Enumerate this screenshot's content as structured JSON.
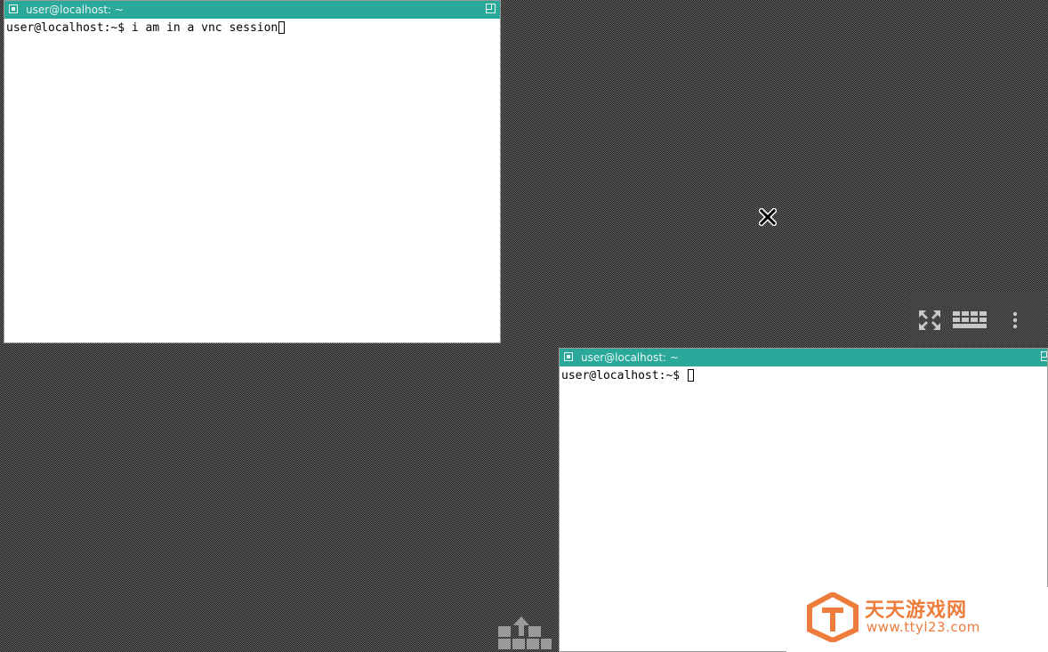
{
  "terminals": [
    {
      "title": "user@localhost: ~",
      "prompt": "user@localhost:~$ ",
      "command": "i am in a vnc session"
    },
    {
      "title": "user@localhost: ~",
      "prompt": "user@localhost:~$ ",
      "command": ""
    }
  ],
  "colors": {
    "titlebar": "#2aa89a",
    "watermark": "#ee7c3b"
  },
  "icons": {
    "vnc_toolbar": [
      "fullscreen-icon",
      "keyboard-icon",
      "more-vertical-icon"
    ],
    "desktop": [
      "x-cursor-icon",
      "upload-icon"
    ]
  },
  "watermark": {
    "title": "天天游戏网",
    "url": "www.ttyl23.com"
  }
}
